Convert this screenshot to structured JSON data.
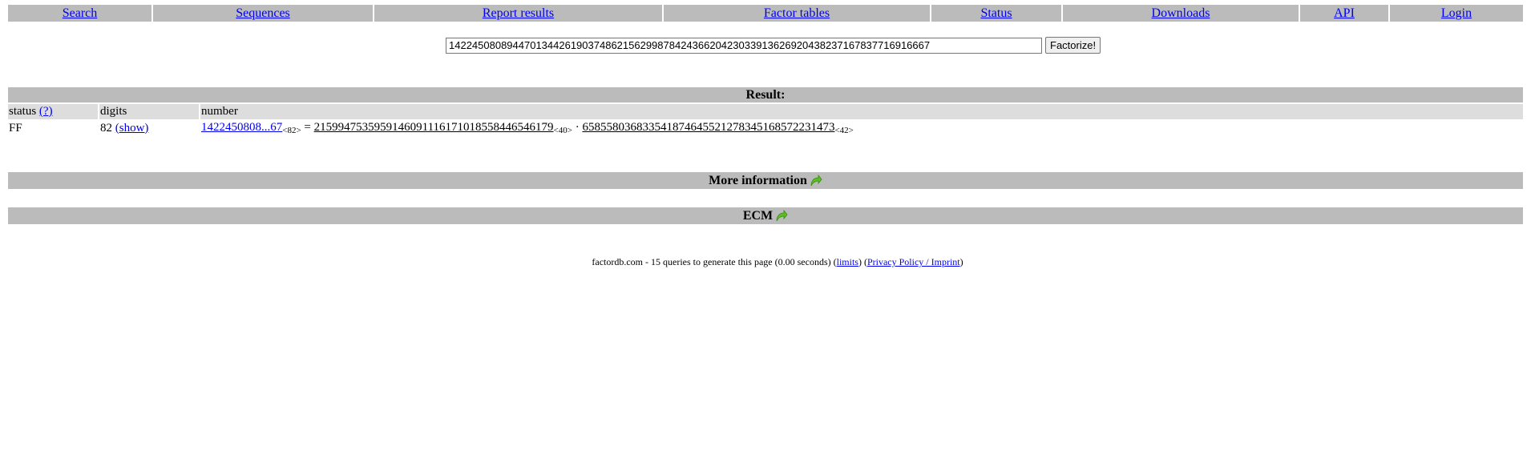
{
  "nav": {
    "items": [
      "Search",
      "Sequences",
      "Report results",
      "Factor tables",
      "Status",
      "Downloads",
      "API",
      "Login"
    ]
  },
  "search": {
    "value": "14224508089447013442619037486215629987842436620423033913626920438237167837716916667",
    "button": "Factorize!"
  },
  "result": {
    "title": "Result:",
    "columns": {
      "status": "status",
      "status_help": "(?)",
      "digits": "digits",
      "number": "number"
    },
    "row": {
      "status": "FF",
      "digits": "82",
      "show": "(show)",
      "number_short": "1422450808...67",
      "number_sub": "<82>",
      "equals": "=",
      "factor1": "2159947535959146091116171018558446546179",
      "factor1_sub": "<40>",
      "dot": "·",
      "factor2": "658558036833541874645521278345168572231473",
      "factor2_sub": "<42>"
    }
  },
  "sections": {
    "more_info": "More information",
    "ecm": "ECM"
  },
  "footer": {
    "prefix": "factordb.com - 15 queries to generate this page (0.00 seconds) (",
    "limits": "limits",
    "middle": ") (",
    "privacy": "Privacy Policy / Imprint",
    "suffix": ")"
  },
  "colors": {
    "bar": "#bbbbbb",
    "colhead": "#dddddd",
    "link": "#0000ee",
    "arrow": "#5bbf21"
  },
  "icons": {
    "expand": "green-curved-arrow-icon"
  }
}
